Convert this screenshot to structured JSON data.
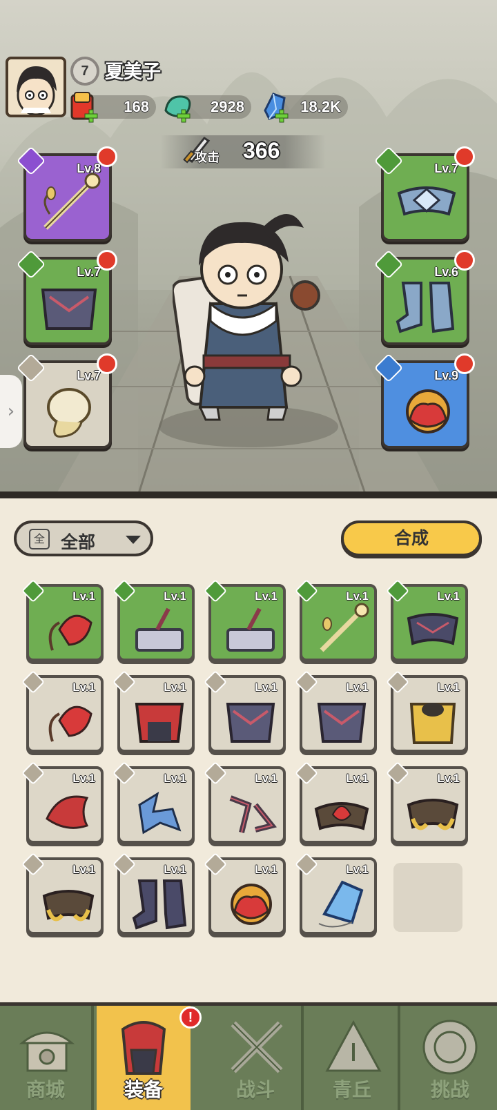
{
  "player": {
    "level": "7",
    "name": "夏美子"
  },
  "currencies": [
    {
      "icon": "red-envelope-icon",
      "value": "168"
    },
    {
      "icon": "jade-dragon-icon",
      "value": "2928"
    },
    {
      "icon": "blue-crystal-icon",
      "value": "18.2K"
    }
  ],
  "attack": {
    "label": "攻击",
    "value": "366"
  },
  "equipped": [
    {
      "slot": "weapon",
      "level": "Lv.8",
      "rarity": "purple",
      "icon": "flower-sword-icon"
    },
    {
      "slot": "armor",
      "level": "Lv.7",
      "rarity": "green",
      "icon": "dark-armor-icon"
    },
    {
      "slot": "wrist",
      "level": "Lv.7",
      "rarity": "gray",
      "icon": "bone-bracer-icon"
    },
    {
      "slot": "belt",
      "level": "Lv.7",
      "rarity": "green",
      "icon": "ice-belt-icon"
    },
    {
      "slot": "boots",
      "level": "Lv.6",
      "rarity": "green",
      "icon": "ice-boots-icon"
    },
    {
      "slot": "accessory",
      "level": "Lv.9",
      "rarity": "blue",
      "icon": "lotus-orb-icon"
    }
  ],
  "filter": {
    "icon_text": "全",
    "label": "全部"
  },
  "compose_label": "合成",
  "inventory": [
    {
      "level": "Lv.1",
      "rarity": "green",
      "icon": "red-flower-whip-icon"
    },
    {
      "level": "Lv.1",
      "rarity": "green",
      "icon": "stone-anvil-icon"
    },
    {
      "level": "Lv.1",
      "rarity": "green",
      "icon": "stone-anvil-icon"
    },
    {
      "level": "Lv.1",
      "rarity": "green",
      "icon": "flower-sword-icon"
    },
    {
      "level": "Lv.1",
      "rarity": "green",
      "icon": "dark-belt-icon"
    },
    {
      "level": "Lv.1",
      "rarity": "gray",
      "icon": "red-flower-whip-icon"
    },
    {
      "level": "Lv.1",
      "rarity": "gray",
      "icon": "red-armor-icon"
    },
    {
      "level": "Lv.1",
      "rarity": "gray",
      "icon": "dark-armor-icon"
    },
    {
      "level": "Lv.1",
      "rarity": "gray",
      "icon": "dark-armor-icon"
    },
    {
      "level": "Lv.1",
      "rarity": "gray",
      "icon": "gold-armor-icon"
    },
    {
      "level": "Lv.1",
      "rarity": "gray",
      "icon": "red-bracer-icon"
    },
    {
      "level": "Lv.1",
      "rarity": "gray",
      "icon": "blue-bracer-icon"
    },
    {
      "level": "Lv.1",
      "rarity": "gray",
      "icon": "dark-bracer-icon"
    },
    {
      "level": "Lv.1",
      "rarity": "gray",
      "icon": "lotus-belt-icon"
    },
    {
      "level": "Lv.1",
      "rarity": "gray",
      "icon": "gold-belt-icon"
    },
    {
      "level": "Lv.1",
      "rarity": "gray",
      "icon": "gold-belt-icon"
    },
    {
      "level": "Lv.1",
      "rarity": "gray",
      "icon": "dark-boots-icon"
    },
    {
      "level": "Lv.1",
      "rarity": "gray",
      "icon": "lotus-orb-icon"
    },
    {
      "level": "Lv.1",
      "rarity": "gray",
      "icon": "blue-crystal-pendant-icon"
    }
  ],
  "nav": [
    {
      "label": "商城",
      "icon": "shop-icon",
      "active": false
    },
    {
      "label": "装备",
      "icon": "equipment-icon",
      "active": true,
      "alert": "!"
    },
    {
      "label": "战斗",
      "icon": "crossed-swords-icon",
      "active": false
    },
    {
      "label": "青丘",
      "icon": "mountain-icon",
      "active": false
    },
    {
      "label": "挑战",
      "icon": "challenge-disc-icon",
      "active": false
    }
  ],
  "colors": {
    "accent": "#f8c94a",
    "green_rarity": "#6fae52",
    "purple_rarity": "#9a62d0",
    "blue_rarity": "#4f8fe0",
    "nav_bg": "#6a7d58"
  }
}
